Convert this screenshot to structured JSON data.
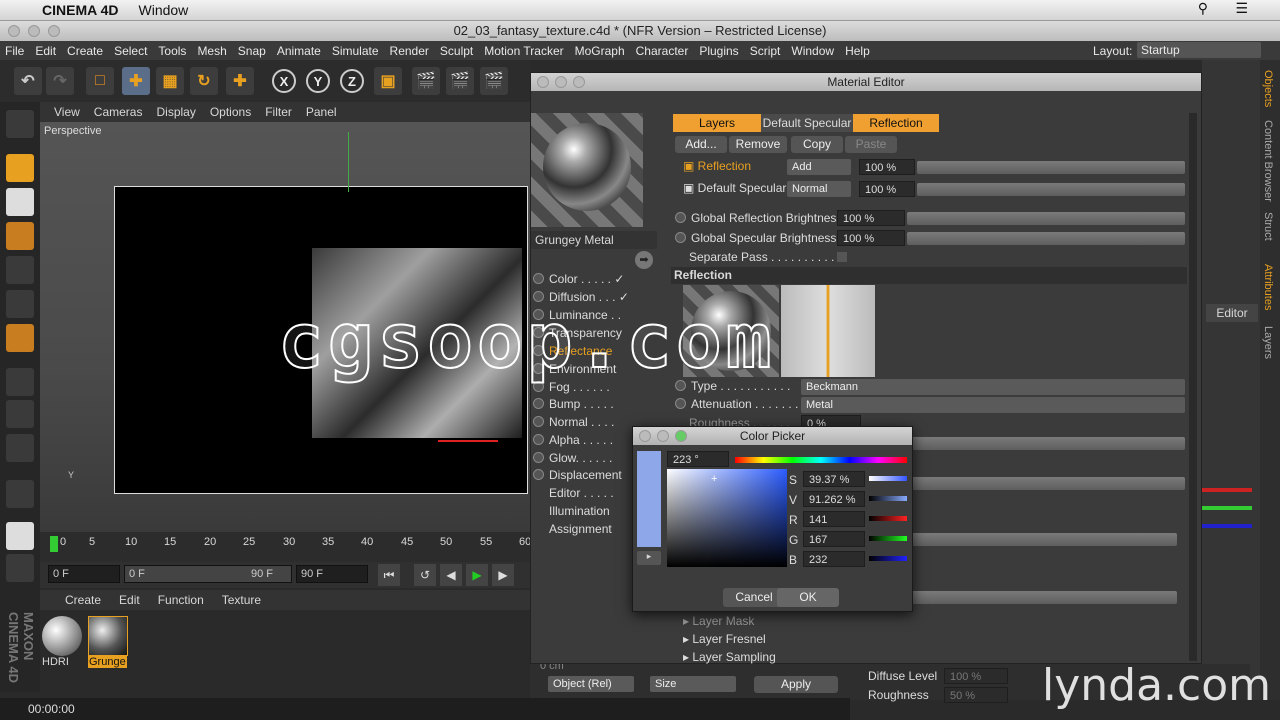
{
  "mac_menu": {
    "apple": "",
    "app": "CINEMA 4D",
    "window": "Window"
  },
  "window_title": "02_03_fantasy_texture.c4d * (NFR Version – Restricted License)",
  "menu": [
    "File",
    "Edit",
    "Create",
    "Select",
    "Tools",
    "Mesh",
    "Snap",
    "Animate",
    "Simulate",
    "Render",
    "Sculpt",
    "Motion Tracker",
    "MoGraph",
    "Character",
    "Plugins",
    "Script",
    "Window",
    "Help"
  ],
  "layout": {
    "label": "Layout:",
    "value": "Startup"
  },
  "toolbar": {
    "x": "X",
    "y": "Y",
    "z": "Z"
  },
  "viewport_menu": [
    "View",
    "Cameras",
    "Display",
    "Options",
    "Filter",
    "Panel"
  ],
  "viewport_label": "Perspective",
  "timeline": {
    "ticks": [
      "0",
      "5",
      "10",
      "15",
      "20",
      "25",
      "30",
      "35",
      "40",
      "45",
      "50",
      "55",
      "60"
    ]
  },
  "transport": {
    "start": "0 F",
    "cur": "0 F",
    "end_inner": "90 F",
    "end": "90 F"
  },
  "material_manager": {
    "menu": [
      "Create",
      "Edit",
      "Function",
      "Texture"
    ],
    "materials": [
      {
        "name": "HDRI"
      },
      {
        "name": "Grunge"
      }
    ]
  },
  "status": {
    "time": "00:00:00"
  },
  "material_editor": {
    "title": "Material Editor",
    "material_name": "Grungey Metal",
    "channels": [
      {
        "label": "Color . . . . .",
        "check": "✓"
      },
      {
        "label": "Diffusion . . .",
        "check": "✓"
      },
      {
        "label": "Luminance . .",
        "check": ""
      },
      {
        "label": "Transparency",
        "check": ""
      },
      {
        "label": "Reflectance",
        "check": ""
      },
      {
        "label": "Environment",
        "check": ""
      },
      {
        "label": "Fog . . . . . .",
        "check": ""
      },
      {
        "label": "Bump . . . . .",
        "check": ""
      },
      {
        "label": "Normal . . . .",
        "check": ""
      },
      {
        "label": "Alpha . . . . .",
        "check": ""
      },
      {
        "label": "Glow. . . . . .",
        "check": ""
      },
      {
        "label": "Displacement",
        "check": ""
      },
      {
        "label": "Editor . . . . .",
        "check": ""
      },
      {
        "label": "Illumination",
        "check": ""
      },
      {
        "label": "Assignment",
        "check": ""
      }
    ],
    "tabs": [
      "Layers",
      "Default Specular",
      "Reflection"
    ],
    "buttons": {
      "add": "Add...",
      "remove": "Remove",
      "copy": "Copy",
      "paste": "Paste"
    },
    "layer_rows": [
      {
        "name": "Reflection",
        "mode": "Add",
        "pct": "100 %"
      },
      {
        "name": "Default Specular",
        "mode": "Normal",
        "pct": "100 %"
      }
    ],
    "global_refl": {
      "label": "Global Reflection Brightness",
      "value": "100 %"
    },
    "global_spec": {
      "label": "Global Specular Brightness",
      "value": "100 %"
    },
    "separate_pass": "Separate Pass . . . . . . . . . . .",
    "section": "Reflection",
    "type": {
      "label": "Type . . . . . . . . . . .",
      "value": "Beckmann"
    },
    "attenuation": {
      "label": "Attenuation . . . . . . .",
      "value": "Metal"
    },
    "roughness": {
      "label": "Roughness . . . . . .",
      "value": "0 %"
    },
    "sub_sections": [
      "Layer Mask",
      "Layer Fresnel",
      "Layer Sampling"
    ]
  },
  "color_picker": {
    "title": "Color Picker",
    "hue": "223 °",
    "s": {
      "label": "S",
      "value": "39.37 %"
    },
    "v": {
      "label": "V",
      "value": "91.262 %"
    },
    "r": {
      "label": "R",
      "value": "141"
    },
    "g": {
      "label": "G",
      "value": "167"
    },
    "b": {
      "label": "B",
      "value": "232"
    },
    "swatch": "#8da7e8",
    "cancel": "Cancel",
    "ok": "OK"
  },
  "attributes": {
    "editor_btn": "Editor",
    "object_rel": "Object (Rel)",
    "size": "Size",
    "apply": "Apply",
    "z_field": "0 cm",
    "diffuse_level": {
      "label": "Diffuse Level",
      "value": "100 %"
    },
    "roughness": {
      "label": "Roughness",
      "value": "50 %"
    }
  },
  "side_tabs": [
    "Objects",
    "Content Browser",
    "Struct",
    "Attributes",
    "Layers"
  ],
  "watermarks": {
    "cgsoop": "cgsoop.com",
    "lynda": "lynda.com",
    "maxon": "MAXON CINEMA 4D"
  }
}
